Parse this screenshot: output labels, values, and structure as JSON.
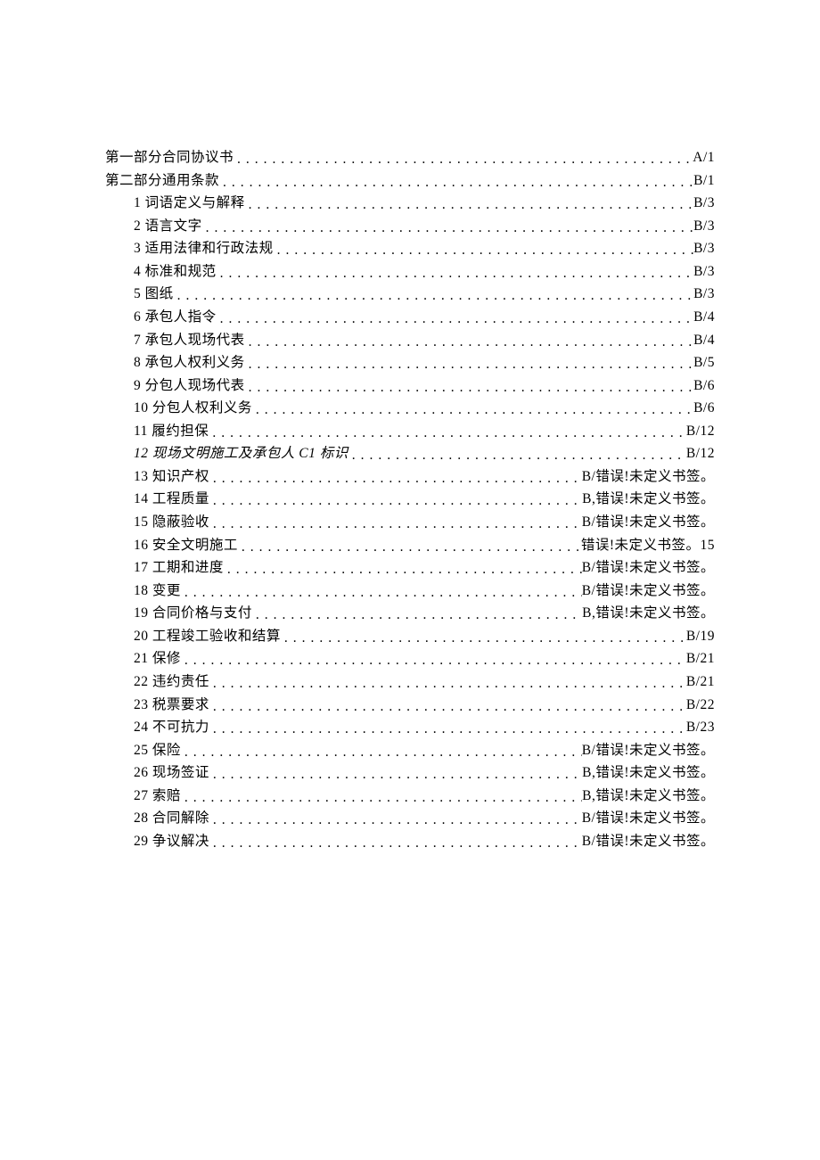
{
  "toc": [
    {
      "level": 0,
      "title": "第一部分合同协议书",
      "page": "A/1",
      "italic": false
    },
    {
      "level": 0,
      "title": "第二部分通用条款",
      "page": "B/1",
      "italic": false
    },
    {
      "level": 1,
      "title": "1 词语定义与解释",
      "page": "B/3",
      "italic": false
    },
    {
      "level": 1,
      "title": "2 语言文字",
      "page": "B/3",
      "italic": false
    },
    {
      "level": 1,
      "title": "3 适用法律和行政法规",
      "page": "B/3",
      "italic": false
    },
    {
      "level": 1,
      "title": "4 标准和规范",
      "page": "B/3",
      "italic": false
    },
    {
      "level": 1,
      "title": "5 图纸",
      "page": "B/3",
      "italic": false
    },
    {
      "level": 1,
      "title": "6 承包人指令",
      "page": "B/4",
      "italic": false
    },
    {
      "level": 1,
      "title": "7 承包人现场代表",
      "page": "B/4",
      "italic": false
    },
    {
      "level": 1,
      "title": "8 承包人权利义务",
      "page": "B/5",
      "italic": false
    },
    {
      "level": 1,
      "title": "9 分包人现场代表",
      "page": "B/6",
      "italic": false
    },
    {
      "level": 1,
      "title": "10 分包人权利义务",
      "page": "B/6",
      "italic": false
    },
    {
      "level": 1,
      "title": "11 履约担保",
      "page": "B/12",
      "italic": false
    },
    {
      "level": 1,
      "title": "12 现场文明施工及承包人 C1 标识",
      "page": "B/12",
      "italic": true
    },
    {
      "level": 1,
      "title": "13 知识产权 ",
      "page": "B/错误!未定义书签。",
      "italic": false
    },
    {
      "level": 1,
      "title": "14 工程质量 ",
      "page": "B,错误!未定义书签。",
      "italic": false
    },
    {
      "level": 1,
      "title": "15 隐蔽验收 ",
      "page": "B/错误!未定义书签。",
      "italic": false
    },
    {
      "level": 1,
      "title": "16 安全文明施工",
      "page": " 错误!未定义书签。15",
      "italic": false
    },
    {
      "level": 1,
      "title": "17 工期和进度 ",
      "page": "B/错误!未定义书签。",
      "italic": false
    },
    {
      "level": 1,
      "title": "18 变更 ",
      "page": "B/错误!未定义书签。",
      "italic": false
    },
    {
      "level": 1,
      "title": "19 合同价格与支付 ",
      "page": "B,错误!未定义书签。",
      "italic": false
    },
    {
      "level": 1,
      "title": "20 工程竣工验收和结算",
      "page": "B/19",
      "italic": false
    },
    {
      "level": 1,
      "title": "21 保修",
      "page": "B/21",
      "italic": false
    },
    {
      "level": 1,
      "title": "22 违约责任",
      "page": "B/21",
      "italic": false
    },
    {
      "level": 1,
      "title": "23 税票要求",
      "page": "B/22",
      "italic": false
    },
    {
      "level": 1,
      "title": "24 不可抗力",
      "page": "B/23",
      "italic": false
    },
    {
      "level": 1,
      "title": "25 保险 ",
      "page": "B/错误!未定义书签。",
      "italic": false
    },
    {
      "level": 1,
      "title": "26 现场签证 ",
      "page": "B,错误!未定义书签。",
      "italic": false
    },
    {
      "level": 1,
      "title": "27 索赔 ",
      "page": "B,错误!未定义书签。",
      "italic": false
    },
    {
      "level": 1,
      "title": "28 合同解除 ",
      "page": "B/错误!未定义书签。",
      "italic": false
    },
    {
      "level": 1,
      "title": "29 争议解决 ",
      "page": "B/错误!未定义书签。",
      "italic": false
    }
  ]
}
